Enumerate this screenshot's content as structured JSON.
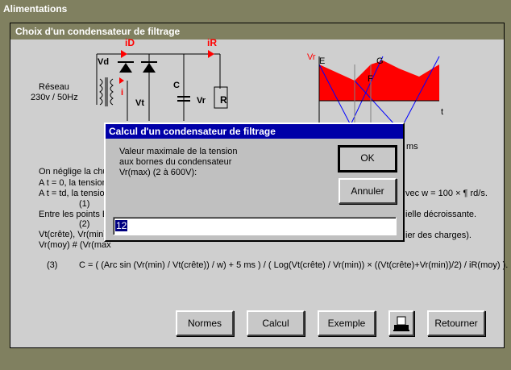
{
  "window": {
    "title": "Alimentations"
  },
  "panel": {
    "title": "Choix d'un condensateur de filtrage"
  },
  "circuit": {
    "iD": "iD",
    "iR": "iR",
    "Vd": "Vd",
    "reseau_line1": "Réseau",
    "reseau_line2": "230v / 50Hz",
    "i": "i",
    "Vt": "Vt",
    "C": "C",
    "Vr": "Vr",
    "R": "R"
  },
  "graph": {
    "ylabel": "Vr",
    "xlabel": "t",
    "E": "E",
    "G": "G",
    "F": "F",
    "ms": "ms"
  },
  "body": {
    "line1": "On néglige la chu",
    "line2": "A  t = 0, la tension",
    "line2_right": "vec  w = 100 × ¶  rd/s.",
    "line3": "A  t = td, la tensio",
    "n1": "(1)",
    "line4": "Entre les points  E",
    "line4_right": "ielle décroissante.",
    "n2": "(2)",
    "line5": "Vt(crête), Vr(min)",
    "line5_right": "ier des charges).",
    "line6": "Vr(moy) # (Vr(max",
    "n3": "(3)",
    "formula": "C = ( (Arc sin (Vr(min) / Vt(crête)) / w) + 5 ms )  /  ( Log(Vt(crête) / Vr(min))  ×  ((Vt(crête)+Vr(min))/2) / iR(moy) )."
  },
  "buttons": {
    "normes": "Normes",
    "calcul": "Calcul",
    "exemple": "Exemple",
    "retourner": "Retourner"
  },
  "dialog": {
    "title": "Calcul d'un condensateur de filtrage",
    "label1": "Valeur maximale de la tension",
    "label2": "aux bornes du condensateur",
    "label3": "Vr(max)    (2 à 600V):",
    "ok": "OK",
    "cancel": "Annuler",
    "value": "12"
  },
  "colors": {
    "accent_red": "#ff0000",
    "title_bar": "#0000a8",
    "panel_title": "#808060"
  }
}
